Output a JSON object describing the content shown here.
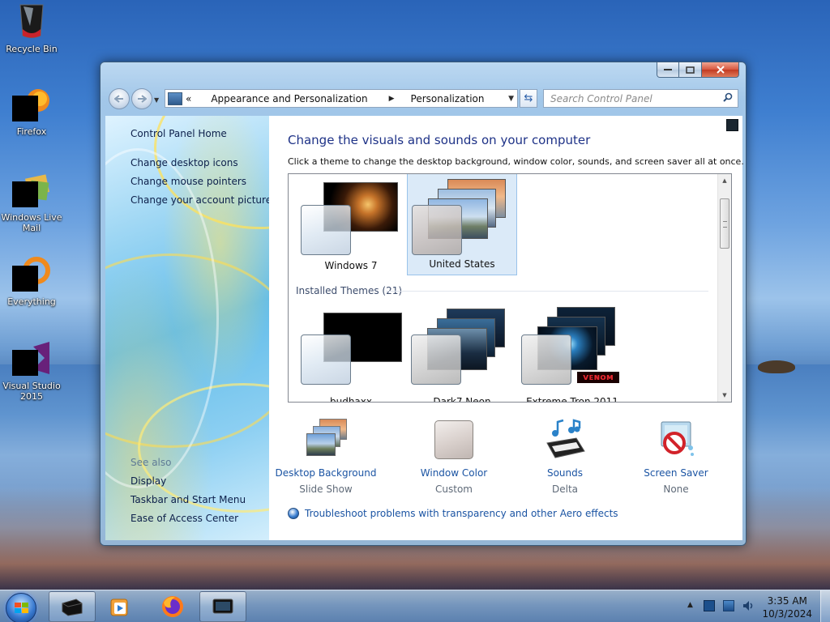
{
  "desktop": {
    "icons": [
      {
        "label": "Recycle Bin",
        "icon": "recycle-bin-icon"
      },
      {
        "label": "Firefox",
        "icon": "firefox-icon"
      },
      {
        "label": "Windows Live Mail",
        "icon": "windows-live-mail-icon"
      },
      {
        "label": "Everything",
        "icon": "everything-icon"
      },
      {
        "label": "Visual Studio 2015",
        "icon": "visual-studio-icon"
      }
    ]
  },
  "window": {
    "address": {
      "overflow": "«",
      "segments": [
        "Appearance and Personalization",
        "Personalization"
      ]
    },
    "search": {
      "placeholder": "Search Control Panel"
    },
    "left_pane": {
      "home": "Control Panel Home",
      "links": [
        "Change desktop icons",
        "Change mouse pointers",
        "Change your account picture"
      ],
      "see_also_title": "See also",
      "see_also": [
        "Display",
        "Taskbar and Start Menu",
        "Ease of Access Center"
      ]
    },
    "content": {
      "heading": "Change the visuals and sounds on your computer",
      "subheading": "Click a theme to change the desktop background, window color, sounds, and screen saver all at once.",
      "my_themes": [
        {
          "name": "Windows 7",
          "selected": false
        },
        {
          "name": "United States",
          "selected": true
        }
      ],
      "installed_title": "Installed Themes (21)",
      "installed_themes": [
        {
          "name": "budhaxx"
        },
        {
          "name": "Dark7 Neon"
        },
        {
          "name": "Extreme Tron 2011"
        }
      ],
      "options": [
        {
          "label": "Desktop Background",
          "value": "Slide Show"
        },
        {
          "label": "Window Color",
          "value": "Custom"
        },
        {
          "label": "Sounds",
          "value": "Delta"
        },
        {
          "label": "Screen Saver",
          "value": "None"
        }
      ],
      "troubleshoot": "Troubleshoot problems with transparency and other Aero effects"
    }
  },
  "taskbar": {
    "clock": {
      "time": "3:35 AM",
      "date": "10/3/2024"
    }
  },
  "colors": {
    "link": "#1b54a3",
    "heading": "#1e3287",
    "selection": "#dbeaf8",
    "close": "#c23a22"
  }
}
